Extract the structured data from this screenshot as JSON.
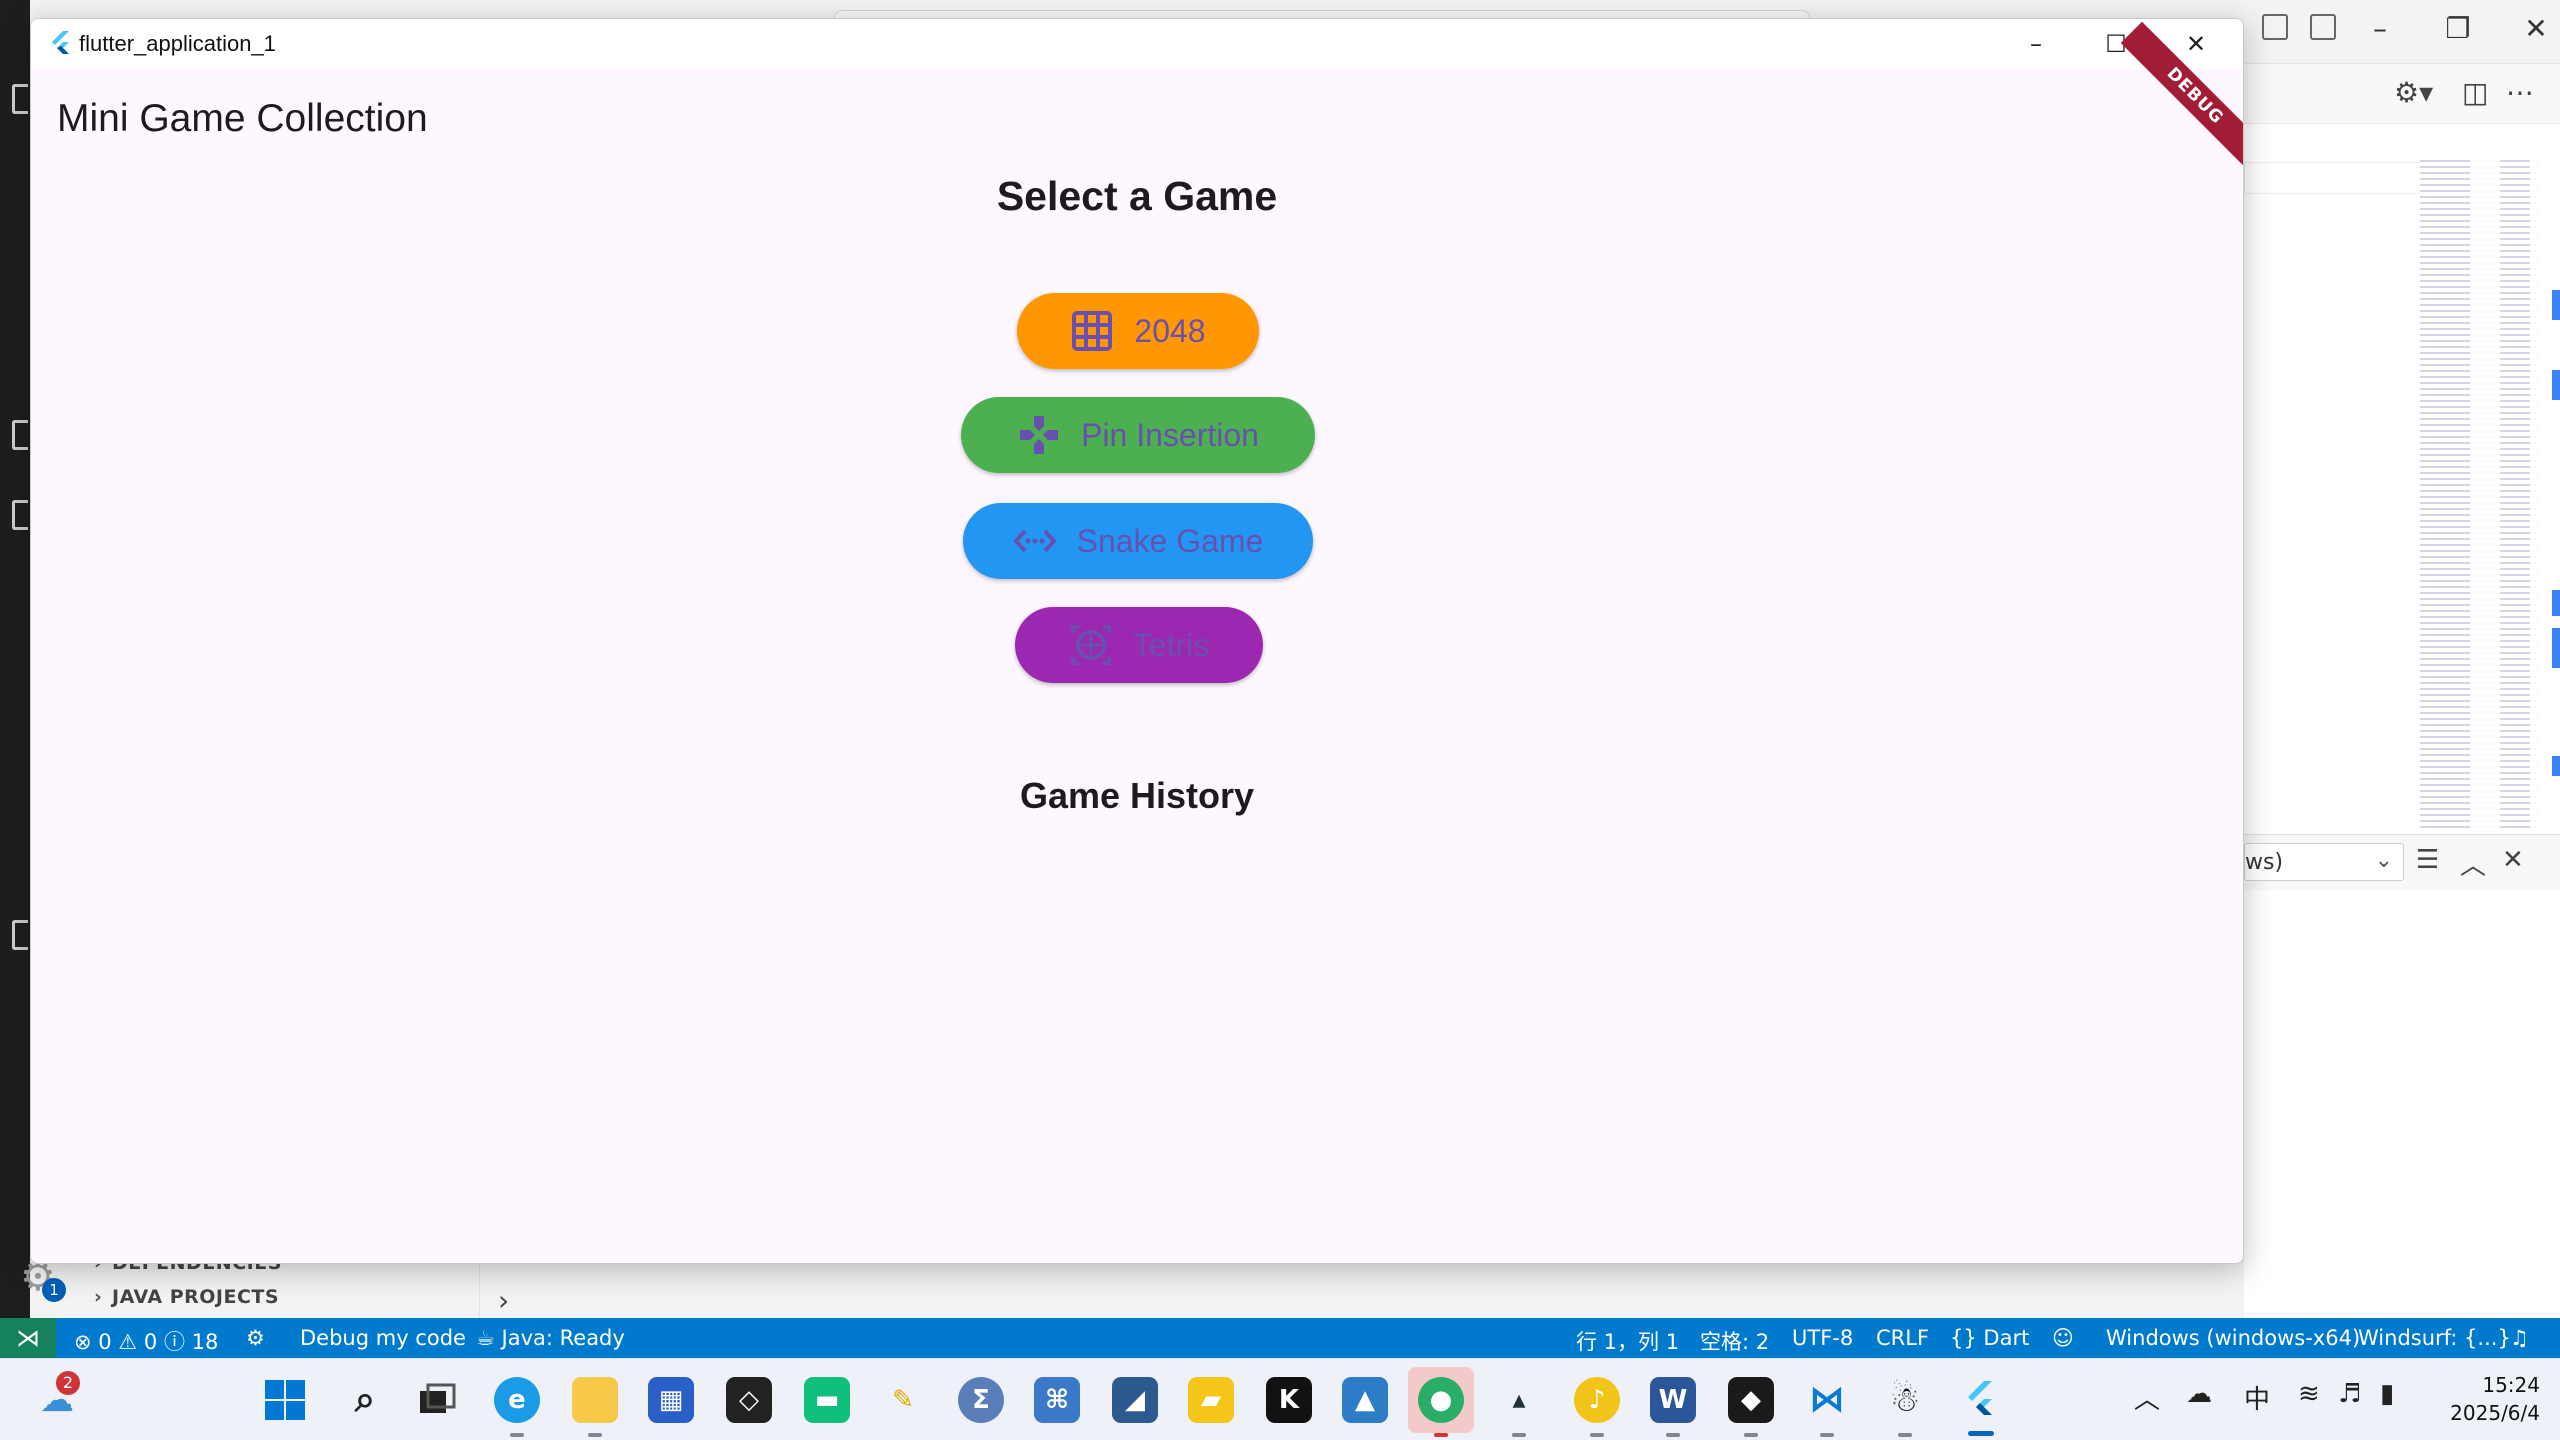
{
  "app": {
    "window_title": "flutter_application_1",
    "appbar_title": "Mini Game Collection",
    "debug_banner": "DEBUG",
    "select_heading": "Select a Game",
    "history_heading": "Game History",
    "games": [
      {
        "label": "2048",
        "color": "#ff9800",
        "icon": "grid-icon"
      },
      {
        "label": "Pin Insertion",
        "color": "#4caf50",
        "icon": "gamepad-icon"
      },
      {
        "label": "Snake Game",
        "color": "#2196f3",
        "icon": "code-arrows-icon"
      },
      {
        "label": "Tetris",
        "color": "#9c27b0",
        "icon": "sports-icon"
      }
    ],
    "label_color": "#6950b0"
  },
  "vscode": {
    "explorer": {
      "dependencies": "DEPENDENCIES",
      "java_projects": "JAVA PROJECTS"
    },
    "panel_select": "ws)",
    "settings_badge": "1",
    "status": {
      "errors": "0",
      "warnings": "0",
      "infos": "18",
      "debug": "Debug my code",
      "java": "Java: Ready",
      "position": "行 1，列 1",
      "spaces": "空格: 2",
      "encoding": "UTF-8",
      "eol": "CRLF",
      "language": "Dart",
      "device": "Windows (windows-x64)",
      "windsurf": "Windsurf: {...}"
    }
  },
  "taskbar": {
    "weather_badge": "2",
    "ime": "中",
    "time": "15:24",
    "date": "2025/6/4"
  }
}
